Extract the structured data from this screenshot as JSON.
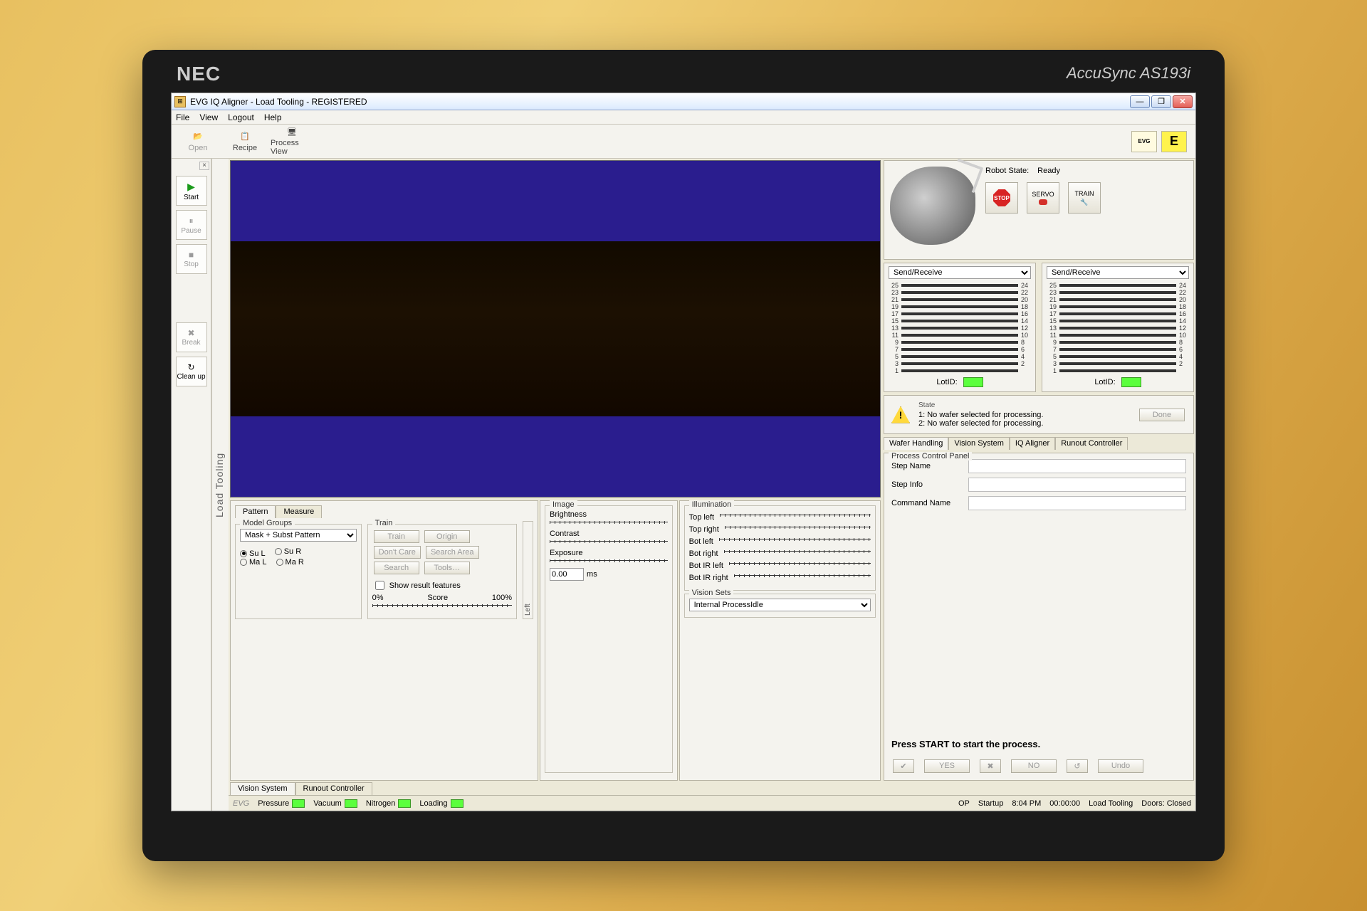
{
  "window": {
    "title": "EVG IQ Aligner - Load Tooling - REGISTERED",
    "minimize": "—",
    "maximize": "❐",
    "close": "✕"
  },
  "menus": {
    "file": "File",
    "view": "View",
    "logout": "Logout",
    "help": "Help"
  },
  "toolbar": {
    "open": "Open",
    "recipe": "Recipe",
    "process_view": "Process View",
    "evg_badge": "EVG",
    "e_badge": "E"
  },
  "left_tools": {
    "start": "Start",
    "pause": "Pause",
    "stop": "Stop",
    "break": "Break",
    "cleanup": "Clean up"
  },
  "vstrip": "Load Tooling",
  "pattern_panel": {
    "tab_pattern": "Pattern",
    "tab_measure": "Measure",
    "group_model": "Model Groups",
    "model_select": "Mask + Subst Pattern",
    "radio_su_l": "Su L",
    "radio_su_r": "Su R",
    "radio_ma_l": "Ma L",
    "radio_ma_r": "Ma R",
    "group_train": "Train",
    "btn_train": "Train",
    "btn_origin": "Origin",
    "btn_dontcare": "Don't Care",
    "btn_searcharea": "Search Area",
    "btn_search": "Search",
    "btn_tools": "Tools…",
    "chk_showresult": "Show result features",
    "score_0": "0%",
    "score_label": "Score",
    "score_100": "100%",
    "side_label": "Left"
  },
  "image_panel": {
    "title": "Image",
    "brightness": "Brightness",
    "contrast": "Contrast",
    "exposure": "Exposure",
    "exposure_val": "0.00",
    "exposure_unit": "ms"
  },
  "illum_panel": {
    "title": "Illumination",
    "top_left": "Top left",
    "top_right": "Top right",
    "bot_left": "Bot left",
    "bot_right": "Bot right",
    "bot_ir_left": "Bot IR left",
    "bot_ir_right": "Bot IR right",
    "vision_sets": "Vision Sets",
    "vision_sel": "Internal ProcessIdle"
  },
  "robot": {
    "state_label": "Robot State:",
    "state_value": "Ready",
    "stop": "STOP",
    "servo": "SERVO",
    "train": "TRAIN"
  },
  "cassette": {
    "select": "Send/Receive",
    "lotid": "LotID:",
    "left_ids": [
      "25",
      "23",
      "21",
      "19",
      "17",
      "15",
      "13",
      "11",
      "9",
      "7",
      "5",
      "3",
      "1"
    ],
    "right_ids": [
      "24",
      "22",
      "20",
      "18",
      "16",
      "14",
      "12",
      "10",
      "8",
      "6",
      "4",
      "2"
    ]
  },
  "state_panel": {
    "title": "State",
    "line1": "1: No wafer selected for processing.",
    "line2": "2: No wafer selected for processing.",
    "btn_done": "Done"
  },
  "right_tabs": {
    "wafer": "Wafer Handling",
    "vision": "Vision System",
    "iq": "IQ Aligner",
    "runout": "Runout Controller"
  },
  "pcp": {
    "title": "Process Control Panel",
    "step_name": "Step Name",
    "step_info": "Step Info",
    "cmd_name": "Command Name",
    "start_msg": "Press START to start the process.",
    "yes": "YES",
    "no": "NO",
    "undo": "Undo"
  },
  "bottom_tabs": {
    "vision": "Vision System",
    "runout": "Runout Controller"
  },
  "statusbar": {
    "tag": "EVG",
    "pressure": "Pressure",
    "vacuum": "Vacuum",
    "nitrogen": "Nitrogen",
    "loading": "Loading",
    "op": "OP",
    "startup": "Startup",
    "time": "8:04 PM",
    "elapsed": "00:00:00",
    "mode": "Load Tooling",
    "doors": "Doors: Closed"
  }
}
